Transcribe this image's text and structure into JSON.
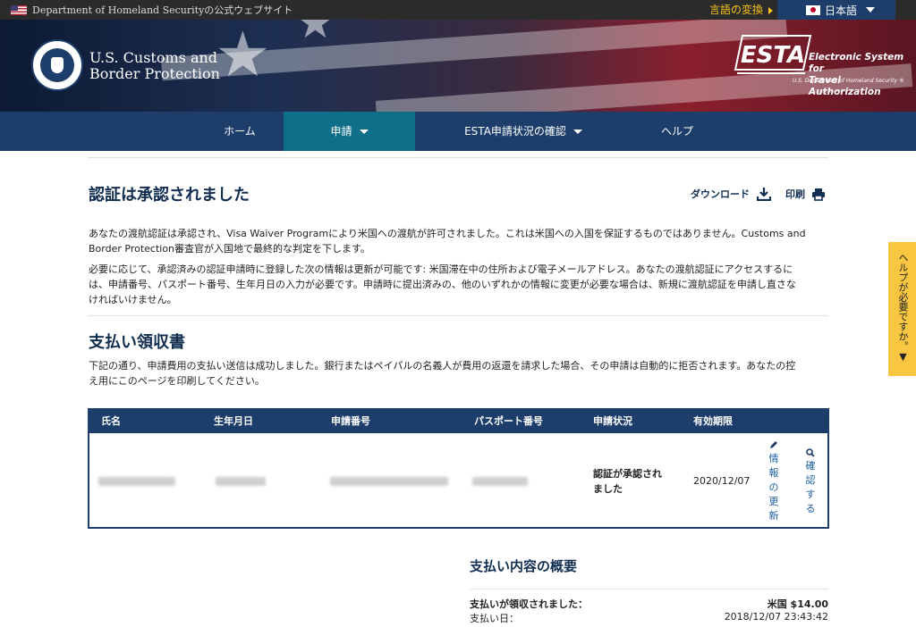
{
  "gov_banner": {
    "text": "Department of Homeland Securityの公式ウェブサイト"
  },
  "language": {
    "link_label": "言語の変換",
    "selected": "日本語"
  },
  "header": {
    "agency_line1": "U.S. Customs and",
    "agency_line2": "Border Protection",
    "esta_logo_text": "ESTA",
    "esta_title_line1": "Electronic System for",
    "esta_title_line2": "Travel Authorization",
    "esta_subtitle": "U.S. Department of Homeland Security ®"
  },
  "nav": {
    "items": [
      {
        "label": "ホーム"
      },
      {
        "label": "申請"
      },
      {
        "label": "ESTA申請状況の確認"
      },
      {
        "label": "ヘルプ"
      }
    ]
  },
  "approval": {
    "title": "認証は承認されました",
    "download_label": "ダウンロード",
    "print_label": "印刷",
    "para1_line1": "あなたの渡航認証は承認され、Visa Waiver Programにより米国への渡航が許可されました。これは米国への入国を保証するものではありません。Customs and",
    "para1_line2": "Border Protection審査官が入国地で最終的な判定を下します。",
    "para2_line1": "必要に応じて、承認済みの認証申請時に登録した次の情報は更新が可能です: 米国滞在中の住所および電子メールアドレス。あなたの渡航認証にアクセスするに",
    "para2_line2": "は、申請番号、パスポート番号、生年月日の入力が必要です。申請時に提出済みの、他のいずれかの情報に変更が必要な場合は、新規に渡航認証を申請し直さな",
    "para2_line3": "ければいけません。"
  },
  "receipt": {
    "title": "支払い領収書",
    "para_line1": "下記の通り、申請費用の支払い送信は成功しました。銀行またはペイパルの名義人が費用の返還を請求した場合、その申請は自動的に拒否されます。あなたの控",
    "para_line2": "え用にこのページを印刷してください。",
    "columns": [
      "氏名",
      "生年月日",
      "申請番号",
      "パスポート番号",
      "申請状況",
      "有効期限"
    ],
    "row": {
      "status_line1": "認証が承認され",
      "status_line2": "ました",
      "expiry": "2020/12/07",
      "update_label": [
        "情",
        "報",
        "の",
        "更",
        "新"
      ],
      "check_label": [
        "確",
        "認",
        "す",
        "る"
      ]
    }
  },
  "summary": {
    "title": "支払い内容の概要",
    "received_label": "支払いが領収されました：",
    "received_amount": "米国 $14.00",
    "date_label": "支払い日：",
    "date_value": "2018/12/07 23:43:42"
  },
  "help_tab": {
    "label": "ヘルプが必要ですか。▼"
  }
}
